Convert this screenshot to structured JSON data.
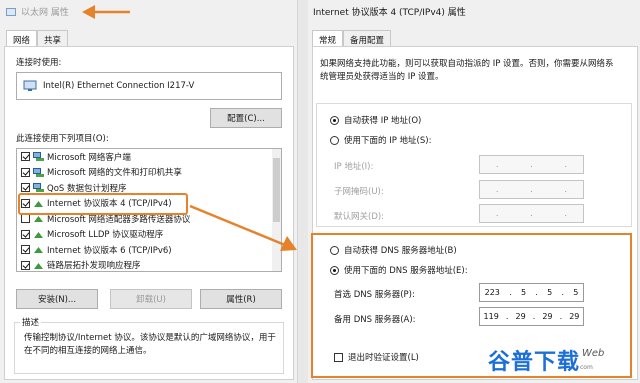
{
  "left_window": {
    "title": "以太网 属性",
    "tabs": [
      "网络",
      "共享"
    ],
    "connect_using_label": "连接时使用:",
    "adapter": "Intel(R) Ethernet Connection I217-V",
    "configure_button": "配置(C)...",
    "items_label": "此连接使用下列项目(O):",
    "items": [
      {
        "label": "Microsoft 网络客户端",
        "checked": true,
        "icon": "network-client-icon"
      },
      {
        "label": "Microsoft 网络的文件和打印机共享",
        "checked": true,
        "icon": "file-share-icon"
      },
      {
        "label": "QoS 数据包计划程序",
        "checked": true,
        "icon": "qos-icon"
      },
      {
        "label": "Internet 协议版本 4 (TCP/IPv4)",
        "checked": true,
        "icon": "protocol-icon"
      },
      {
        "label": "Microsoft 网络适配器多路传送器协议",
        "checked": false,
        "icon": "protocol-icon"
      },
      {
        "label": "Microsoft LLDP 协议驱动程序",
        "checked": true,
        "icon": "protocol-icon"
      },
      {
        "label": "Internet 协议版本 6 (TCP/IPv6)",
        "checked": true,
        "icon": "protocol-icon"
      },
      {
        "label": "链路层拓扑发现响应程序",
        "checked": true,
        "icon": "protocol-icon"
      }
    ],
    "install_button": "安装(N)...",
    "uninstall_button": "卸载(U)",
    "properties_button": "属性(R)",
    "description_label": "描述",
    "description_text": "传输控制协议/Internet 协议。该协议是默认的广域网络协议，用于在不同的相互连接的网络上通信。"
  },
  "right_window": {
    "title": "Internet 协议版本 4 (TCP/IPv4) 属性",
    "tabs": [
      "常规",
      "备用配置"
    ],
    "intro": "如果网络支持此功能，则可以获取自动指派的 IP 设置。否则，你需要从网络系统管理员处获得适当的 IP 设置。",
    "auto_ip_label": "自动获得 IP 地址(O)",
    "manual_ip_label": "使用下面的 IP 地址(S):",
    "ip_address_label": "IP 地址(I):",
    "subnet_label": "子网掩码(U):",
    "gateway_label": "默认网关(D):",
    "auto_dns_label": "自动获得 DNS 服务器地址(B)",
    "manual_dns_label": "使用下面的 DNS 服务器地址(E):",
    "preferred_dns_label": "首选 DNS 服务器(P):",
    "preferred_dns": [
      "223",
      "5",
      "5",
      "5"
    ],
    "alternate_dns_label": "备用 DNS 服务器(A):",
    "alternate_dns": [
      "119",
      "29",
      "29",
      "29"
    ],
    "validate_label": "退出时验证设置(L)",
    "ip_selected": "auto",
    "dns_selected": "manual"
  },
  "watermark": {
    "text": "谷普下载",
    "sub": "Web",
    "small": "com"
  },
  "colors": {
    "highlight": "#e5822b",
    "watermark": "#1c6fd9"
  }
}
